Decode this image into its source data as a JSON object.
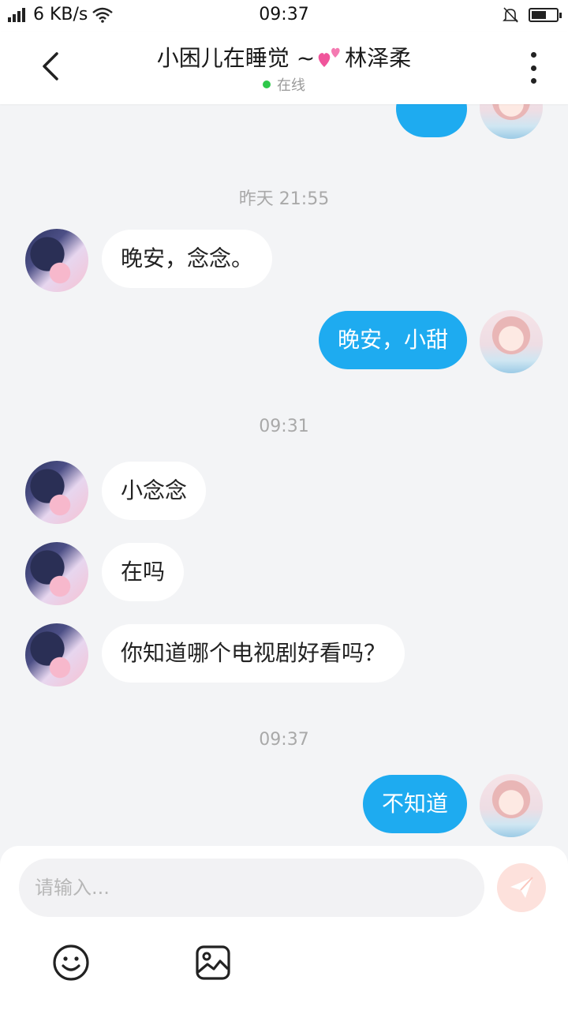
{
  "status_bar": {
    "net_speed": "6 KB/s",
    "time": "09:37",
    "battery_level": 0.6
  },
  "header": {
    "title_prefix": "小困儿在睡觉 ~",
    "title_suffix": "林泽柔",
    "heart_icon": "two-hearts-icon",
    "status": "在线"
  },
  "messages": [
    {
      "type": "time",
      "text": "昨天 21:55"
    },
    {
      "from": "them",
      "text": "晚安，念念。"
    },
    {
      "from": "me",
      "text": "晚安，小甜"
    },
    {
      "type": "time",
      "text": "09:31"
    },
    {
      "from": "them",
      "text": "小念念"
    },
    {
      "from": "them",
      "text": "在吗"
    },
    {
      "from": "them",
      "text": "你知道哪个电视剧好看吗？"
    },
    {
      "type": "time",
      "text": "09:37"
    },
    {
      "from": "me",
      "text": "不知道"
    }
  ],
  "input": {
    "placeholder": "请输入..."
  },
  "colors": {
    "accent": "#1eabf0",
    "online": "#2ec84a",
    "send_button_bg": "#fde1dc"
  },
  "icons": [
    "back-arrow-icon",
    "more-vertical-icon",
    "emoji-icon",
    "image-icon",
    "send-icon"
  ]
}
